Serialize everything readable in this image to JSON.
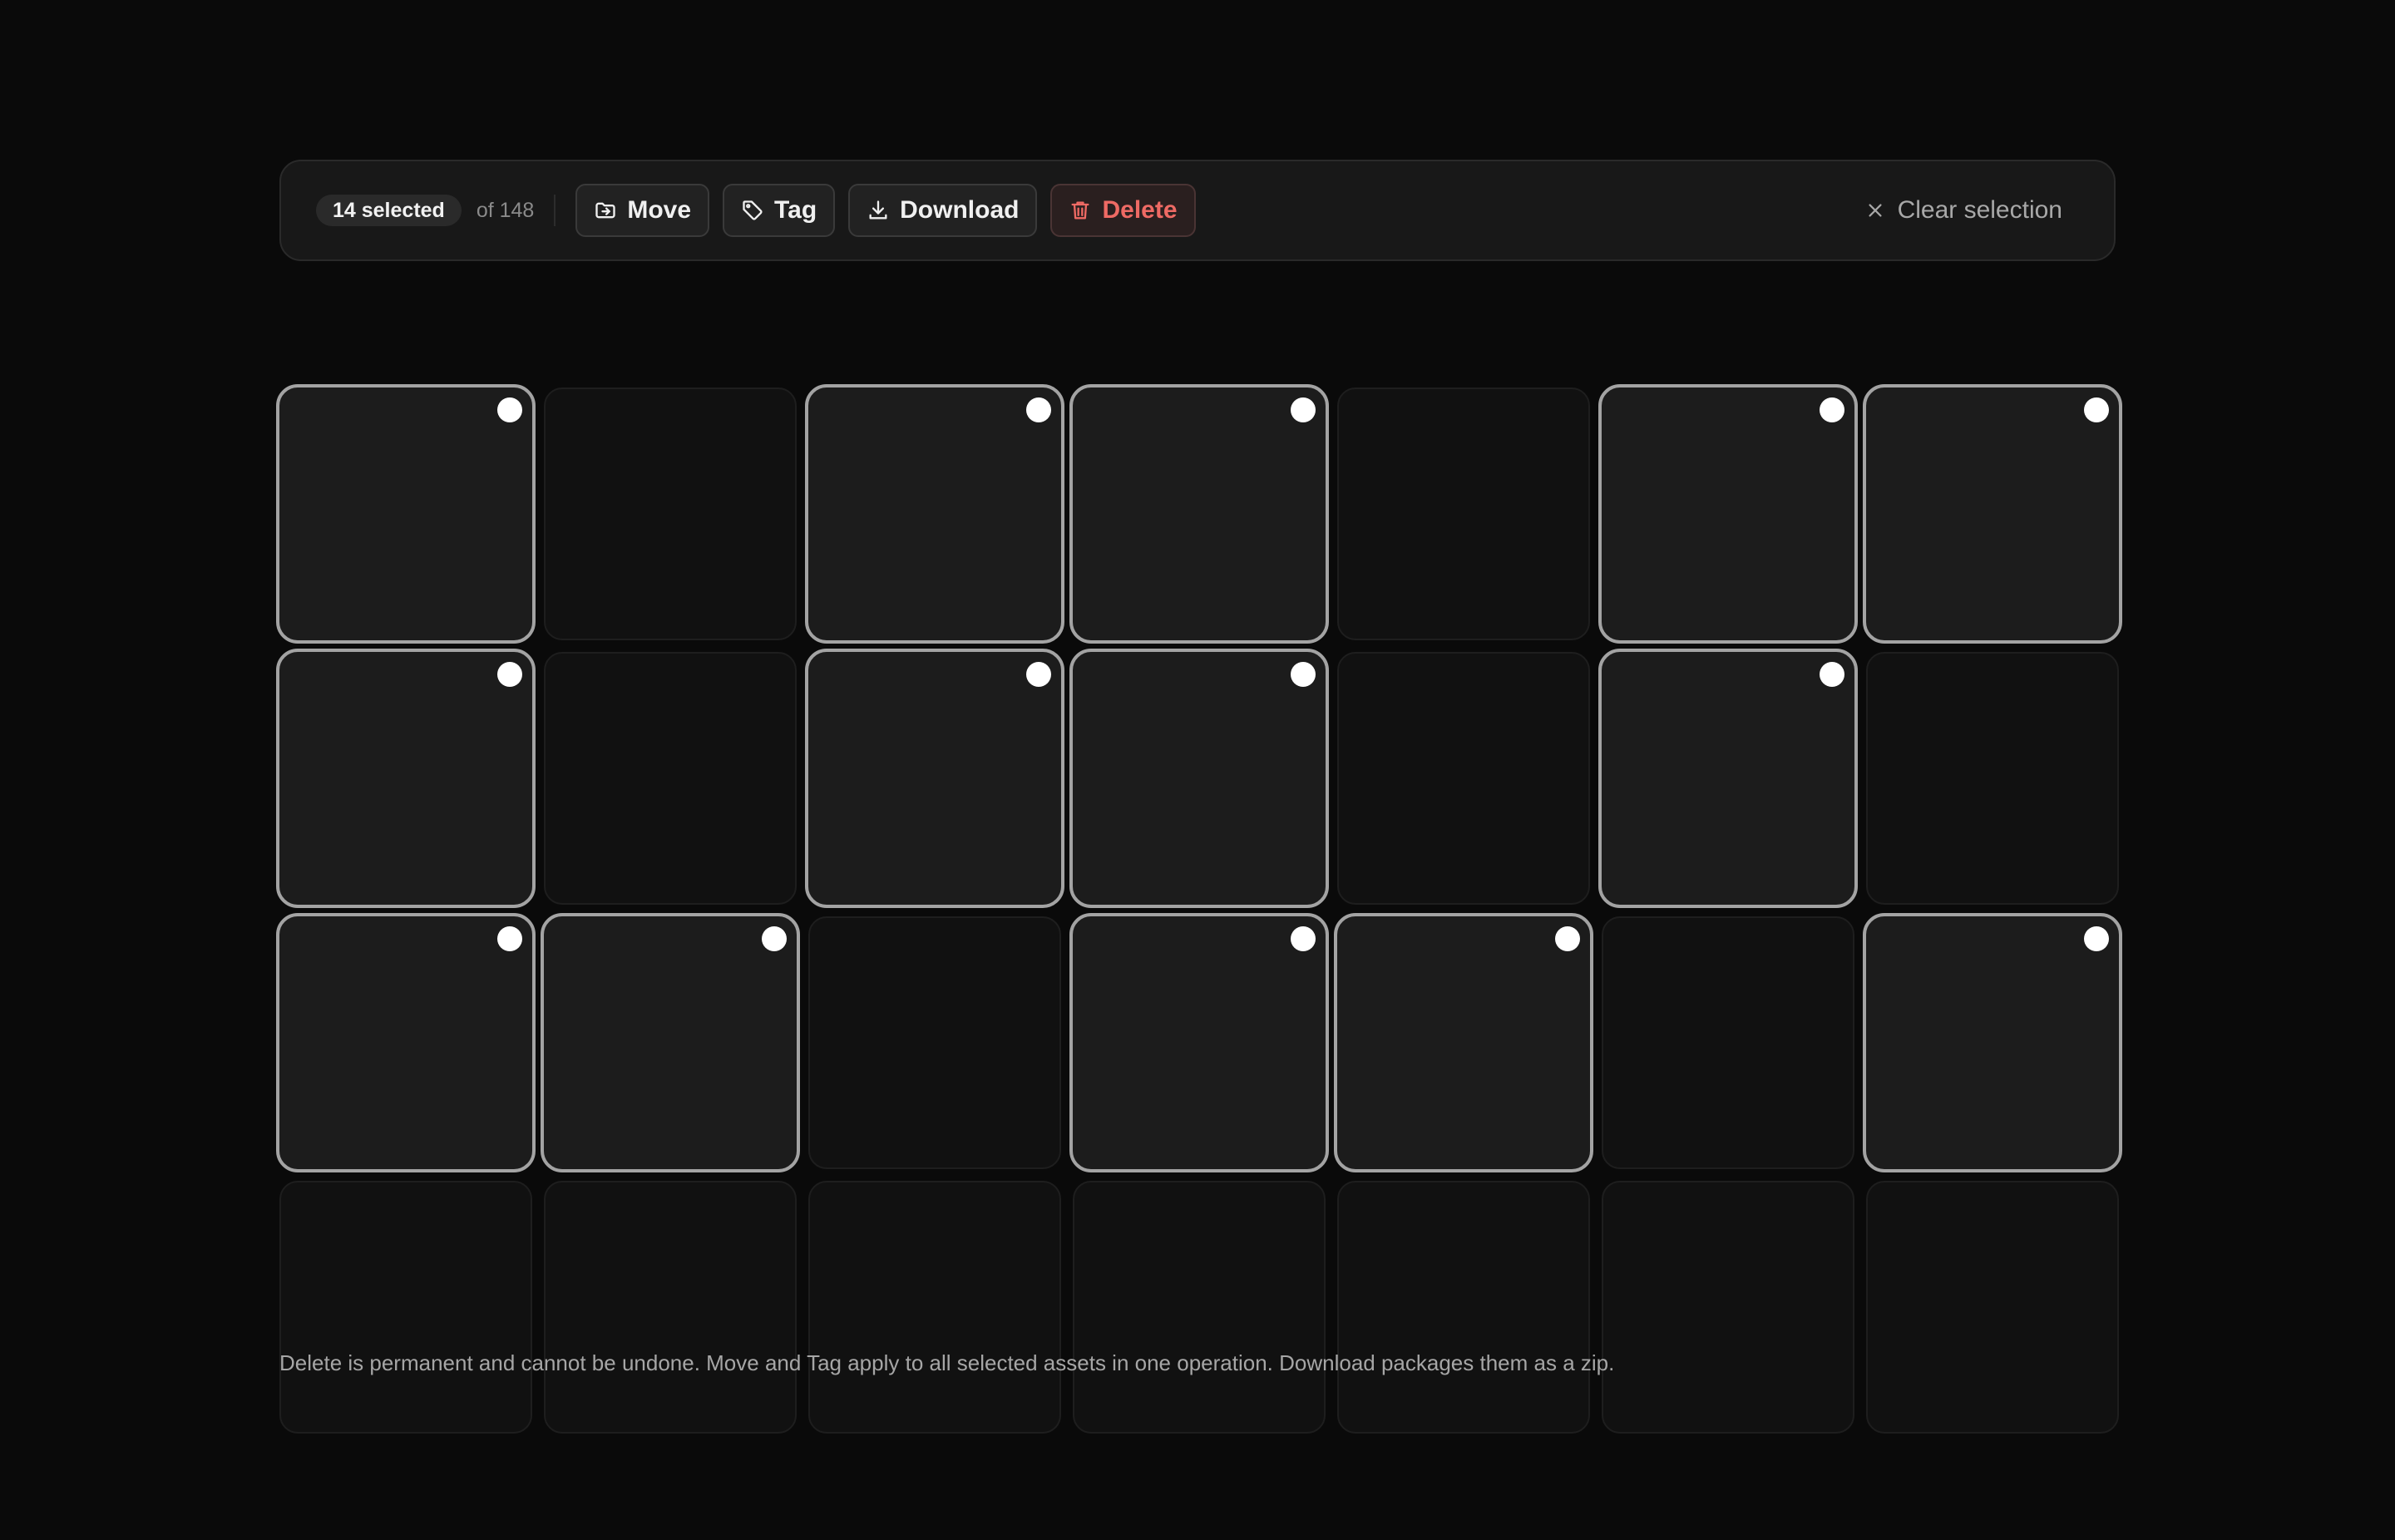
{
  "toolbar": {
    "selected_label": "14 selected",
    "total_label": "of 148",
    "actions": [
      {
        "id": "move",
        "label": "Move",
        "icon": "folder-move-icon"
      },
      {
        "id": "tag",
        "label": "Tag",
        "icon": "tag-icon"
      },
      {
        "id": "download",
        "label": "Download",
        "icon": "download-icon"
      },
      {
        "id": "delete",
        "label": "Delete",
        "icon": "trash-icon",
        "color": "#ee6a64"
      }
    ],
    "clear_label": "Clear selection",
    "clear_icon": "close-icon"
  },
  "grid": {
    "columns": 7,
    "rows": 4,
    "selected": [
      [
        true,
        false,
        true,
        true,
        false,
        true,
        true
      ],
      [
        true,
        false,
        true,
        true,
        false,
        true,
        false
      ],
      [
        true,
        true,
        false,
        true,
        true,
        false,
        true
      ],
      [
        false,
        false,
        false,
        false,
        false,
        false,
        false
      ]
    ]
  },
  "footer": {
    "note": "Delete is permanent and cannot be undone. Move and Tag apply to all selected assets in one operation. Download packages them as a zip."
  },
  "colors": {
    "background": "#0a0a0a",
    "selected_border": "#a3a3a3",
    "danger": "#ee6a64"
  }
}
